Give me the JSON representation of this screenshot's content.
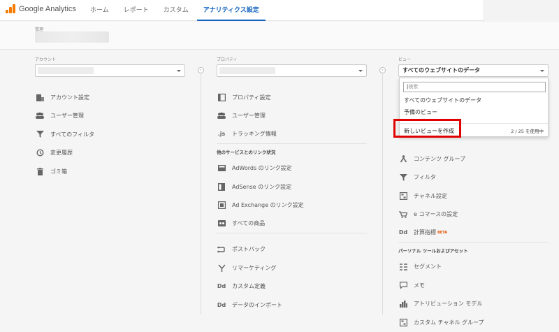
{
  "brand": {
    "name": "Google Analytics"
  },
  "nav": [
    {
      "label": "ホーム",
      "active": false
    },
    {
      "label": "レポート",
      "active": false
    },
    {
      "label": "カスタム",
      "active": false
    },
    {
      "label": "アナリティクス設定",
      "active": true
    }
  ],
  "admin": {
    "label": "管理"
  },
  "account": {
    "label": "アカウント",
    "items": [
      {
        "icon": "building-icon",
        "label": "アカウント設定"
      },
      {
        "icon": "users-icon",
        "label": "ユーザー管理"
      },
      {
        "icon": "filter-icon",
        "label": "すべてのフィルタ"
      },
      {
        "icon": "history-icon",
        "label": "変更履歴"
      },
      {
        "icon": "trash-icon",
        "label": "ゴミ箱"
      }
    ]
  },
  "property": {
    "label": "プロパティ",
    "items": [
      {
        "icon": "property-settings-icon",
        "label": "プロパティ設定"
      },
      {
        "icon": "users-icon",
        "label": "ユーザー管理"
      },
      {
        "icon": "tracking-js-icon",
        "label": "トラッキング情報"
      }
    ],
    "section": "他のサービスとのリンク状況",
    "links": [
      {
        "icon": "adwords-icon",
        "label": "AdWords のリンク設定"
      },
      {
        "icon": "adsense-icon",
        "label": "AdSense のリンク設定"
      },
      {
        "icon": "adexchange-icon",
        "label": "Ad Exchange のリンク設定"
      },
      {
        "icon": "products-icon",
        "label": "すべての商品"
      }
    ],
    "more": [
      {
        "icon": "postback-icon",
        "label": "ポストバック"
      },
      {
        "icon": "remarketing-icon",
        "label": "リマーケティング"
      },
      {
        "icon": "dd-icon",
        "label": "カスタム定義"
      },
      {
        "icon": "dd-icon",
        "label": "データのインポート"
      }
    ]
  },
  "view": {
    "label": "ビュー",
    "selected": "すべてのウェブサイトのデータ",
    "dropdown": {
      "search_placeholder": "検索",
      "options": [
        "すべてのウェブサイトのデータ",
        "予備のビュー"
      ],
      "create_label": "新しいビューを作成",
      "usage": "2 / 25 を使用中"
    },
    "items": [
      {
        "icon": "content-group-icon",
        "label": "コンテンツ グループ"
      },
      {
        "icon": "filter-icon",
        "label": "フィルタ"
      },
      {
        "icon": "channel-icon",
        "label": "チャネル設定"
      },
      {
        "icon": "cart-icon",
        "label": "e コマースの設定"
      },
      {
        "icon": "dd-icon",
        "label": "計算指標",
        "badge": "BETA"
      }
    ],
    "section": "パーソナル ツールおよびアセット",
    "tools": [
      {
        "icon": "segment-icon",
        "label": "セグメント"
      },
      {
        "icon": "memo-icon",
        "label": "メモ"
      },
      {
        "icon": "attribution-icon",
        "label": "アトリビューション モデル"
      },
      {
        "icon": "channel-icon",
        "label": "カスタム チャネル グループ"
      }
    ]
  }
}
